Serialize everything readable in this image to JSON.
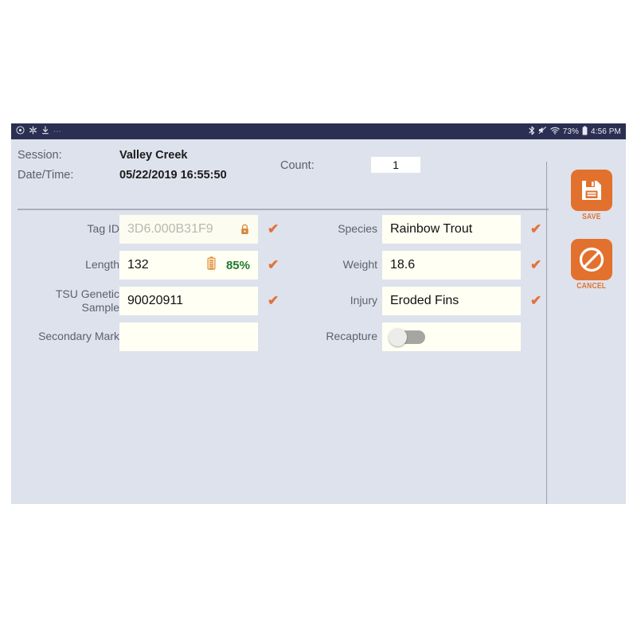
{
  "status_bar": {
    "left_icons": [
      "clock-icon",
      "asterisk-icon",
      "download-icon"
    ],
    "overflow": "⋯",
    "right_icons": [
      "bluetooth-icon",
      "volume-muted-icon",
      "wifi-icon",
      "battery-icon"
    ],
    "battery_percent": "73%",
    "time": "4:56 PM"
  },
  "header": {
    "session_label": "Session:",
    "session_value": "Valley Creek",
    "datetime_label": "Date/Time:",
    "datetime_value": "05/22/2019 16:55:50",
    "count_label": "Count:",
    "count_value": "1"
  },
  "form": {
    "tag_id": {
      "label": "Tag ID",
      "value": "3D6.000B31F9",
      "is_placeholder": true,
      "locked": true,
      "lock_icon": "lock-icon",
      "valid": true
    },
    "length": {
      "label": "Length",
      "value": "132",
      "battery_icon": "battery-icon",
      "battery_percent": "85%",
      "valid": true
    },
    "tsu_genetic_sample": {
      "label": "TSU Genetic Sample",
      "label_line1": "TSU Genetic",
      "label_line2": "Sample",
      "value": "90020911",
      "valid": true
    },
    "secondary_mark": {
      "label": "Secondary Mark",
      "value": "",
      "valid": false
    },
    "species": {
      "label": "Species",
      "value": "Rainbow Trout",
      "valid": true
    },
    "weight": {
      "label": "Weight",
      "value": "18.6",
      "valid": true
    },
    "injury": {
      "label": "Injury",
      "value": "Eroded Fins",
      "valid": true
    },
    "recapture": {
      "label": "Recapture",
      "toggle_on": false
    },
    "check_mark": "✔"
  },
  "actions": {
    "save": {
      "label": "SAVE",
      "icon": "floppy-disk-save-icon"
    },
    "cancel": {
      "label": "CANCEL",
      "icon": "prohibition-cancel-icon"
    }
  },
  "colors": {
    "accent": "#e2712e",
    "status_bar": "#2b2f52",
    "app_background": "#dee2ec",
    "field_background": "#fffff3",
    "valid_check": "#e2723b",
    "battery_percent_text": "#1f7a2e"
  }
}
